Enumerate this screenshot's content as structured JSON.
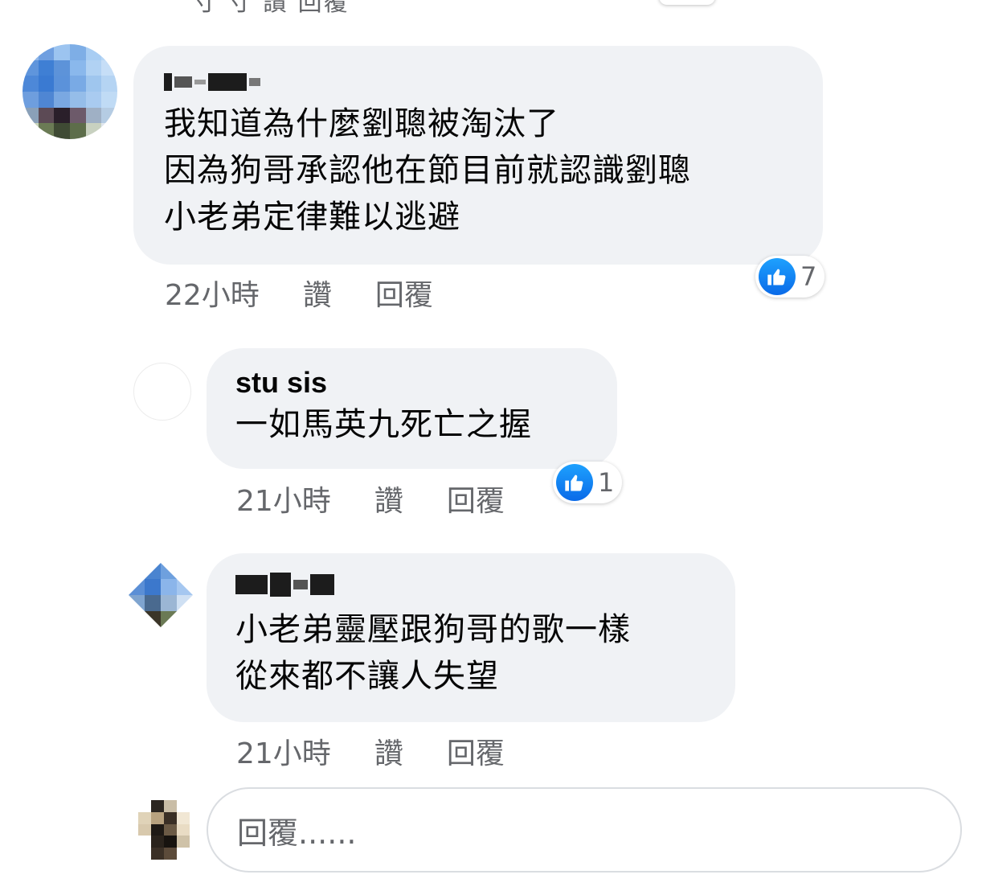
{
  "top_remnant": "寸  寸    讚    回覆",
  "comments": [
    {
      "name": "",
      "text": "我知道為什麼劉聰被淘汰了\n因為狗哥承認他在節目前就認識劉聰\n小老弟定律難以逃避",
      "time": "22小時",
      "like": "讚",
      "reply": "回覆",
      "reaction_count": "7"
    },
    {
      "name": "stu sis",
      "text": "一如馬英九死亡之握",
      "time": "21小時",
      "like": "讚",
      "reply": "回覆",
      "reaction_count": "1"
    },
    {
      "name": "",
      "text": "小老弟靈壓跟狗哥的歌一樣\n從來都不讓人失望",
      "time": "21小時",
      "like": "讚",
      "reply": "回覆"
    }
  ],
  "reply_box": {
    "placeholder": "回覆......"
  },
  "colors": {
    "bubble": "#f0f2f5",
    "meta_text": "#65676b",
    "like_blue": "#1877f2"
  },
  "icons": [
    "like-thumb-icon"
  ]
}
